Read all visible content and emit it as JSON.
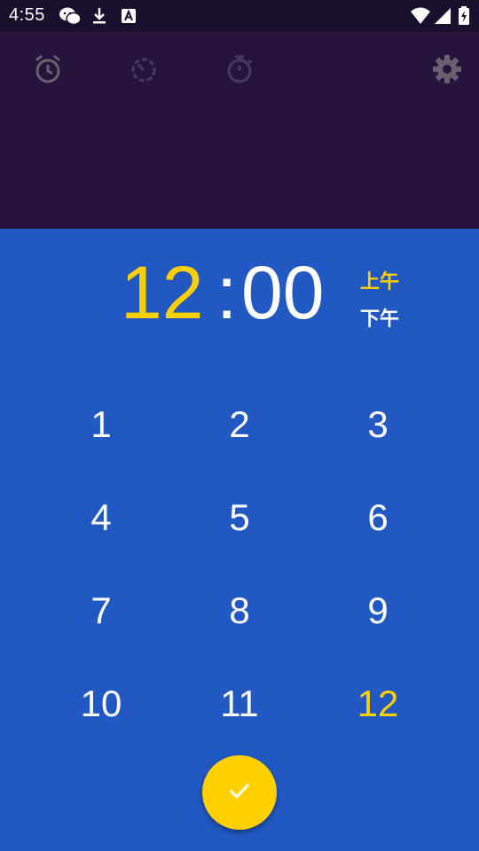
{
  "status_bar": {
    "time": "4:55",
    "icons": [
      "wechat-icon",
      "download-icon",
      "a-icon",
      "wifi-icon",
      "signal-icon",
      "battery-icon"
    ]
  },
  "app_bar": {
    "tabs": [
      {
        "icon": "alarm-icon",
        "active": true
      },
      {
        "icon": "clock-icon",
        "active": false
      },
      {
        "icon": "timer-icon",
        "active": false
      }
    ],
    "settings_icon": "gear-icon"
  },
  "time_picker": {
    "hour": "12",
    "separator": ":",
    "minute": "00",
    "am_label": "上午",
    "pm_label": "下午",
    "selected_period": "am",
    "keys": [
      "1",
      "2",
      "3",
      "4",
      "5",
      "6",
      "7",
      "8",
      "9",
      "10",
      "11",
      "12"
    ],
    "selected_key": "12",
    "confirm_icon": "check-icon"
  },
  "colors": {
    "accent": "#ffd000",
    "picker_bg": "#2158c2",
    "appbar_bg": "#27143c",
    "statusbar_bg": "#1b0f2e"
  }
}
